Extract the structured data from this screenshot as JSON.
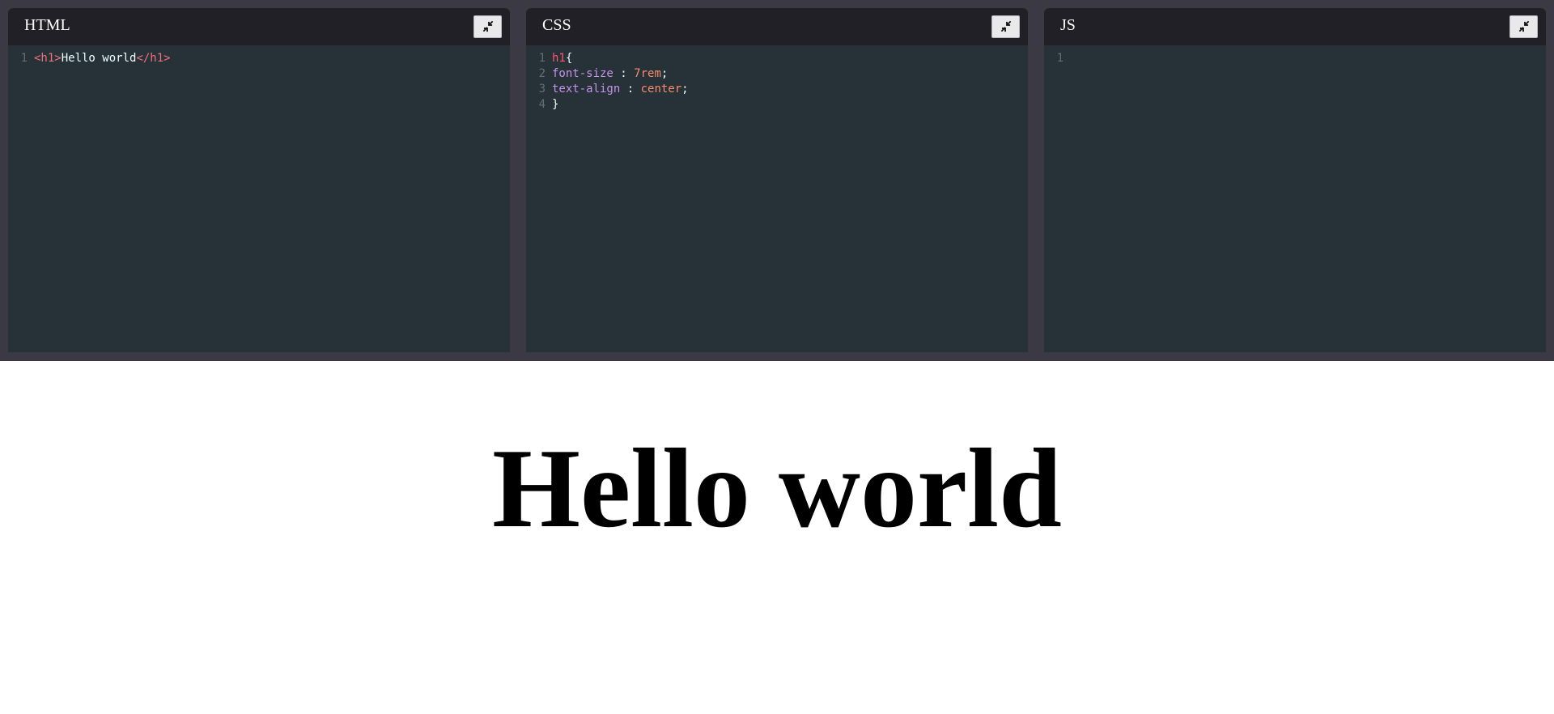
{
  "panels": [
    {
      "title": "HTML",
      "collapse_icon": "collapse-arrows-icon",
      "lines": [
        {
          "number": "1",
          "tokens": [
            {
              "type": "tag",
              "text": "<h1>"
            },
            {
              "type": "text",
              "text": "Hello world"
            },
            {
              "type": "tag",
              "text": "</h1>"
            }
          ]
        }
      ]
    },
    {
      "title": "CSS",
      "collapse_icon": "collapse-arrows-icon",
      "lines": [
        {
          "number": "1",
          "tokens": [
            {
              "type": "sel",
              "text": "h1"
            },
            {
              "type": "text",
              "text": "{"
            }
          ]
        },
        {
          "number": "2",
          "tokens": [
            {
              "type": "prop",
              "text": "font-size"
            },
            {
              "type": "text",
              "text": " : "
            },
            {
              "type": "num",
              "text": "7rem"
            },
            {
              "type": "text",
              "text": ";"
            }
          ]
        },
        {
          "number": "3",
          "tokens": [
            {
              "type": "prop",
              "text": "text-align"
            },
            {
              "type": "text",
              "text": " : "
            },
            {
              "type": "val",
              "text": "center"
            },
            {
              "type": "text",
              "text": ";"
            }
          ]
        },
        {
          "number": "4",
          "tokens": [
            {
              "type": "text",
              "text": "}"
            }
          ]
        }
      ]
    },
    {
      "title": "JS",
      "collapse_icon": "collapse-arrows-icon",
      "lines": [
        {
          "number": "1",
          "tokens": []
        }
      ]
    }
  ],
  "preview": {
    "heading": "Hello world"
  },
  "colors": {
    "editor_bg": "#263238",
    "header_bg": "#212026",
    "frame_bg": "#3b3a44",
    "tag": "#f07178",
    "selector": "#ff5370",
    "property": "#c792ea",
    "number": "#f78c6c"
  }
}
